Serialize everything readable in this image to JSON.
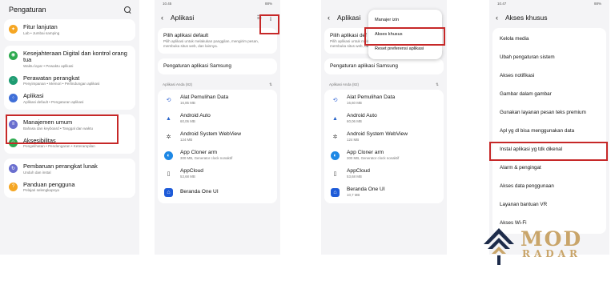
{
  "colors": {
    "highlight": "#c62828",
    "panel_bg": "#f4f4f6",
    "watermark": "#c9a56a"
  },
  "panel1": {
    "title": "Pengaturan",
    "items": [
      {
        "title": "Fitur lanjutan",
        "sub": "Lab • Jumbai samping",
        "icon": "fitur-lanjutan-icon",
        "color": "#f5a623"
      },
      {
        "title": "Kesejahteraan Digital dan kontrol orang tua",
        "sub": "Waktu layar • Pewaktu aplikasi",
        "icon": "digital-wellbeing-icon",
        "color": "#2eaa4f"
      },
      {
        "title": "Perawatan perangkat",
        "sub": "Penyimpanan • Memori • Perlindungan aplikasi",
        "icon": "device-care-icon",
        "color": "#1e9c72"
      },
      {
        "title": "Aplikasi",
        "sub": "Aplikasi default • Pengaturan aplikasi",
        "icon": "apps-icon",
        "color": "#3f6fd8"
      },
      {
        "title": "Manajemen umum",
        "sub": "Bahasa dan keyboard • Tanggal dan waktu",
        "icon": "general-management-icon",
        "color": "#6a6fcf"
      },
      {
        "title": "Aksesibilitas",
        "sub": "Pengelihatan • Pendengaran • Keterampilan",
        "icon": "accessibility-icon",
        "color": "#2eaa4f"
      },
      {
        "title": "Pembaruan perangkat lunak",
        "sub": "Unduh dan instal",
        "icon": "software-update-icon",
        "color": "#6a6fcf"
      },
      {
        "title": "Panduan pengguna",
        "sub": "Pelajari selengkapnya",
        "icon": "user-guide-icon",
        "color": "#f5a623"
      }
    ]
  },
  "panel2": {
    "status_time": "10.45",
    "status_right": "88%",
    "title": "Aplikasi",
    "default_title": "Pilih aplikasi default",
    "default_sub": "Pilih aplikasi untuk melakukan panggilan, mengirim pesan, membuka situs web, dan lainnya.",
    "samsung_settings": "Pengaturan aplikasi Samsung",
    "section_label": "Aplikasi Anda (82)",
    "apps": [
      {
        "name": "Alat Pemulihan Data",
        "size": "16,85 MB",
        "icon": "data-recovery-icon"
      },
      {
        "name": "Android Auto",
        "size": "60,06 MB",
        "icon": "android-auto-icon"
      },
      {
        "name": "Android System WebView",
        "size": "124 MB",
        "icon": "webview-icon"
      },
      {
        "name": "App Cloner arm",
        "size": "300 MB, Generator clock nonaktif",
        "icon": "app-cloner-icon"
      },
      {
        "name": "AppCloud",
        "size": "53,68 MB",
        "icon": "appcloud-icon"
      },
      {
        "name": "Beranda One UI",
        "size": "",
        "icon": "one-ui-home-icon"
      }
    ]
  },
  "panel3": {
    "title": "Aplikasi",
    "default_title": "Pilih aplikasi def",
    "default_sub": "Pilih aplikasi untuk melakukan panggilan, mengirim pesan, membuka situs web, dan lainnya.",
    "samsung_settings": "Pengaturan aplikasi Samsung",
    "section_label": "Aplikasi Anda (82)",
    "menu": [
      "Manajer izin",
      "Akses khusus",
      "Reset preferensi aplikasi"
    ],
    "apps": [
      {
        "name": "Alat Pemulihan Data",
        "size": "16,60 MB",
        "icon": "data-recovery-icon"
      },
      {
        "name": "Android Auto",
        "size": "60,06 MB",
        "icon": "android-auto-icon"
      },
      {
        "name": "Android System WebView",
        "size": "124 MB",
        "icon": "webview-icon"
      },
      {
        "name": "App Cloner arm",
        "size": "300 MB, Generator clock nonaktif",
        "icon": "app-cloner-icon"
      },
      {
        "name": "AppCloud",
        "size": "53,68 MB",
        "icon": "appcloud-icon"
      },
      {
        "name": "Beranda One UI",
        "size": "10,7 MB",
        "icon": "one-ui-home-icon"
      }
    ]
  },
  "panel4": {
    "status_time": "10.47",
    "status_right": "88%",
    "title": "Akses khusus",
    "items": [
      "Kelola media",
      "Ubah pengaturan sistem",
      "Akses notifikasi",
      "Gambar dalam gambar",
      "Gunakan layanan pesan teks premium",
      "Apl yg dl bisa menggunakan data",
      "Instal aplikasi yg tdk dikenal",
      "Alarm & pengingat",
      "Akses data penggunaan",
      "Layanan bantuan VR",
      "Akses Wi-Fi"
    ]
  },
  "watermark": {
    "line1": "MOD",
    "line2": "RADAR"
  }
}
